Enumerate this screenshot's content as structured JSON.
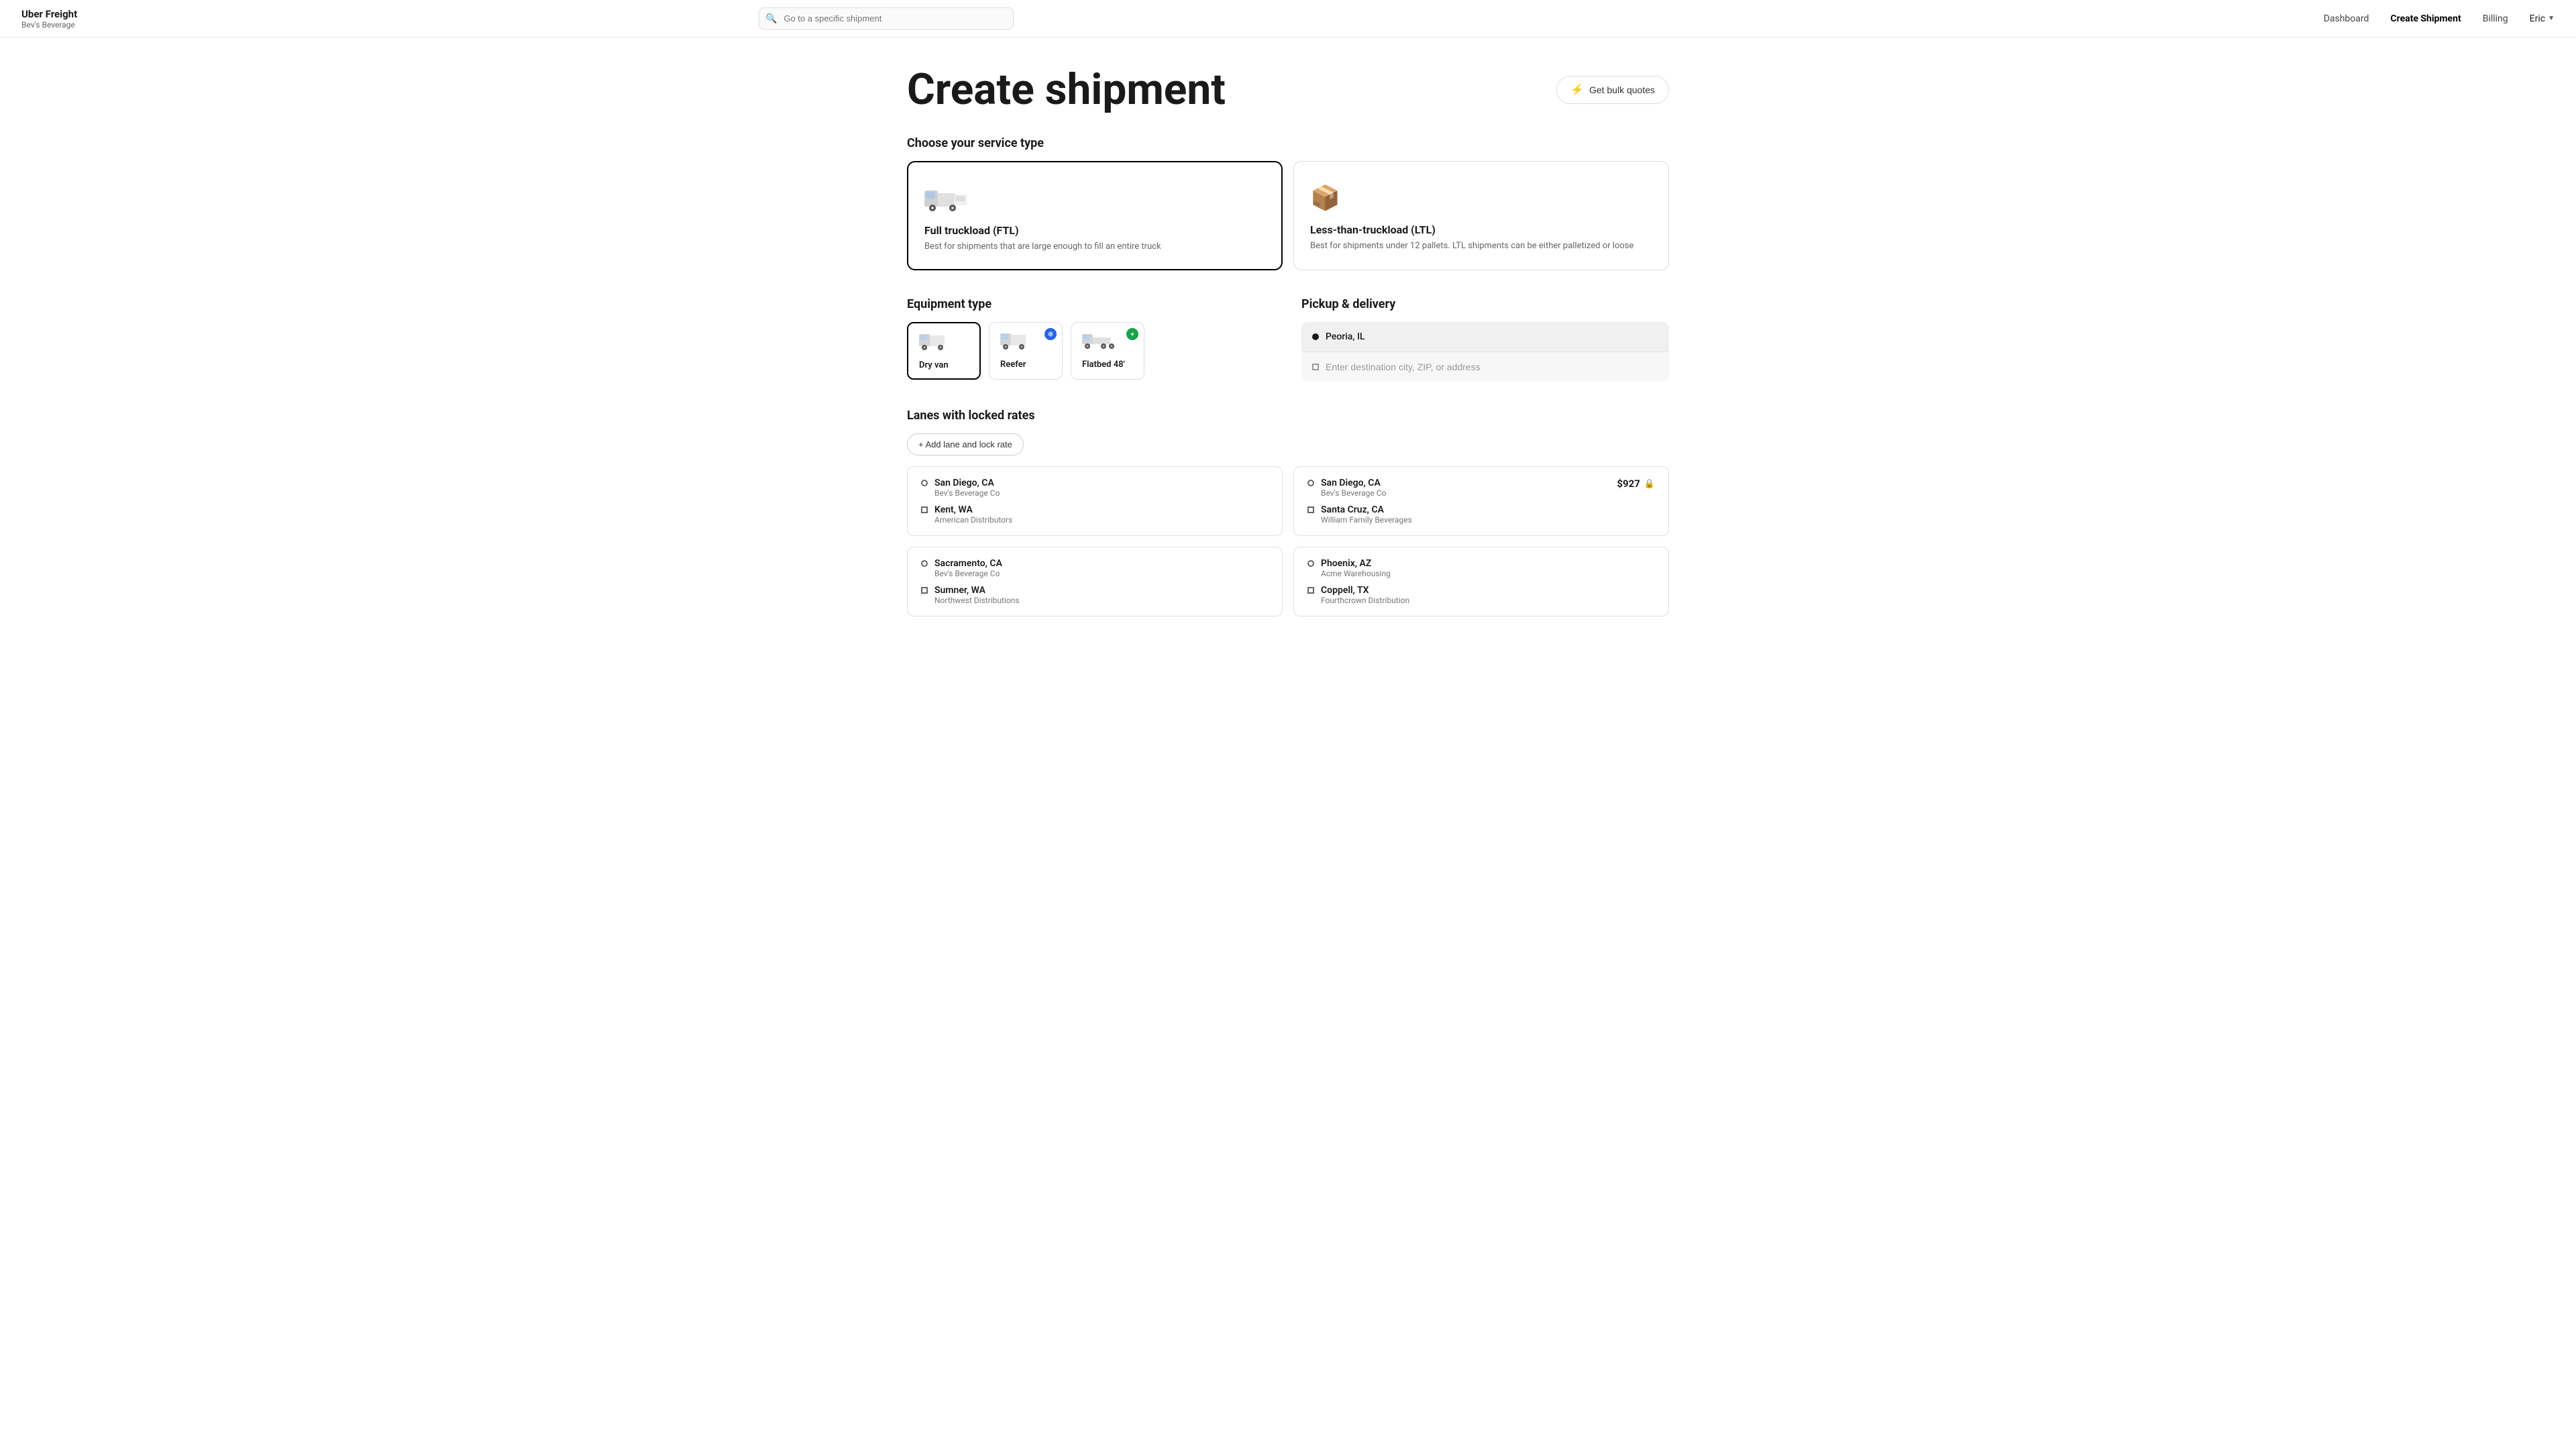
{
  "brand": {
    "name": "Uber Freight",
    "sub": "Bev's Beverage"
  },
  "search": {
    "placeholder": "Go to a specific shipment"
  },
  "nav": {
    "dashboard": "Dashboard",
    "create_shipment": "Create Shipment",
    "billing": "Billing",
    "user": "Eric"
  },
  "page": {
    "title": "Create shipment",
    "bulk_quotes": "Get bulk quotes"
  },
  "service_type": {
    "heading": "Choose your service type",
    "options": [
      {
        "id": "ftl",
        "icon": "🚛",
        "title": "Full truckload (FTL)",
        "desc": "Best for shipments that are large enough to fill an entire truck",
        "selected": true
      },
      {
        "id": "ltl",
        "icon": "📦",
        "title": "Less-than-truckload (LTL)",
        "desc": "Best for shipments under 12 pallets. LTL shipments can be either palletized or loose",
        "selected": false
      }
    ]
  },
  "equipment_type": {
    "heading": "Equipment type",
    "options": [
      {
        "id": "dry-van",
        "label": "Dry van",
        "selected": true,
        "badge": null
      },
      {
        "id": "reefer",
        "label": "Reefer",
        "selected": false,
        "badge": "blue"
      },
      {
        "id": "flatbed",
        "label": "Flatbed 48'",
        "selected": false,
        "badge": "green"
      }
    ]
  },
  "pickup_delivery": {
    "heading": "Pickup & delivery",
    "origin": "Peoria, IL",
    "destination_placeholder": "Enter destination city, ZIP, or address"
  },
  "lanes": {
    "heading": "Lanes with locked rates",
    "add_button": "+ Add lane and lock rate",
    "items": [
      {
        "origin_city": "San Diego, CA",
        "origin_company": "Bev's Beverage Co",
        "dest_city": "Kent, WA",
        "dest_company": "American Distributors",
        "price": null,
        "locked": false
      },
      {
        "origin_city": "San Diego, CA",
        "origin_company": "Bev's Beverage Co",
        "dest_city": "Santa Cruz, CA",
        "dest_company": "William Family Beverages",
        "price": "$927",
        "locked": true
      },
      {
        "origin_city": "Sacramento, CA",
        "origin_company": "Bev's Beverage Co",
        "dest_city": "Sumner, WA",
        "dest_company": "Northwest Distributions",
        "price": null,
        "locked": false
      },
      {
        "origin_city": "Phoenix, AZ",
        "origin_company": "Acme Warehousing",
        "dest_city": "Coppell, TX",
        "dest_company": "Fourthcrown Distribution",
        "price": null,
        "locked": false
      }
    ]
  }
}
